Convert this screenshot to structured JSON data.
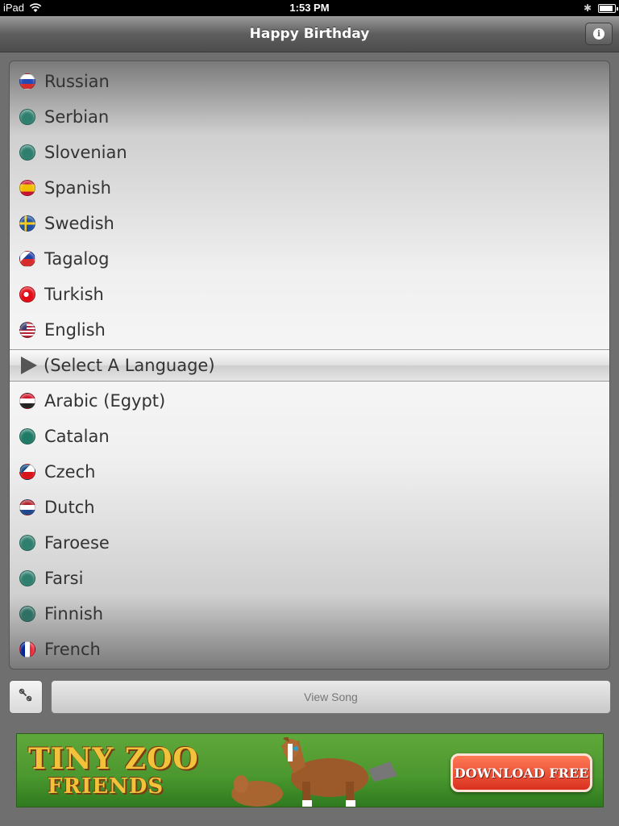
{
  "status_bar": {
    "device": "iPad",
    "time": "1:53 PM",
    "bluetooth_icon": "bluetooth-icon",
    "wifi_icon": "wifi-icon",
    "battery_icon": "battery-icon"
  },
  "nav": {
    "title": "Happy Birthday",
    "info_icon": "info-icon"
  },
  "picker": {
    "selected_label": "(Select A Language)",
    "items": [
      {
        "label": "Russian",
        "flag": "russia-flag-icon",
        "colors": [
          "#ffffff",
          "#2548b3",
          "#d52b2b"
        ]
      },
      {
        "label": "Serbian",
        "flag": "generic-flag-icon",
        "colors": [
          "#2f7f6f"
        ]
      },
      {
        "label": "Slovenian",
        "flag": "generic-flag-icon",
        "colors": [
          "#2f7f6f"
        ]
      },
      {
        "label": "Spanish",
        "flag": "spain-flag-icon",
        "colors": [
          "#c8102e",
          "#f1bf00",
          "#c8102e"
        ]
      },
      {
        "label": "Swedish",
        "flag": "sweden-flag-icon",
        "colors": [
          "#1e4fa3",
          "#f5cc1e"
        ]
      },
      {
        "label": "Tagalog",
        "flag": "philippines-flag-icon",
        "colors": [
          "#1e3fa3",
          "#d52b2b",
          "#ffffff"
        ]
      },
      {
        "label": "Turkish",
        "flag": "turkey-flag-icon",
        "colors": [
          "#e30a17",
          "#ffffff"
        ]
      },
      {
        "label": "English",
        "flag": "usa-flag-icon",
        "colors": [
          "#b22234",
          "#ffffff",
          "#3c3b6e"
        ]
      },
      {
        "label": "(Select A Language)",
        "flag": "play-icon",
        "colors": [
          "#555555"
        ]
      },
      {
        "label": "Arabic (Egypt)",
        "flag": "egypt-flag-icon",
        "colors": [
          "#ce1126",
          "#ffffff",
          "#222222"
        ]
      },
      {
        "label": "Catalan",
        "flag": "generic-flag-icon",
        "colors": [
          "#1f7a66"
        ]
      },
      {
        "label": "Czech",
        "flag": "czech-flag-icon",
        "colors": [
          "#ffffff",
          "#d7141a",
          "#11457e"
        ]
      },
      {
        "label": "Dutch",
        "flag": "netherlands-flag-icon",
        "colors": [
          "#ae1c28",
          "#ffffff",
          "#21468b"
        ]
      },
      {
        "label": "Faroese",
        "flag": "generic-flag-icon",
        "colors": [
          "#2f7f6f"
        ]
      },
      {
        "label": "Farsi",
        "flag": "generic-flag-icon",
        "colors": [
          "#2f7f6f"
        ]
      },
      {
        "label": "Finnish",
        "flag": "generic-flag-icon",
        "colors": [
          "#2f6f64"
        ]
      },
      {
        "label": "French",
        "flag": "france-flag-icon",
        "colors": [
          "#002395",
          "#ffffff",
          "#ed2939"
        ]
      }
    ]
  },
  "controls": {
    "tools_icon": "wrench-icon",
    "view_song_label": "View Song"
  },
  "ad": {
    "title_line1": "TINY ZOO",
    "title_line2": "FRIENDS",
    "cta_label": "DOWNLOAD FREE",
    "image": "horse-illustration"
  }
}
